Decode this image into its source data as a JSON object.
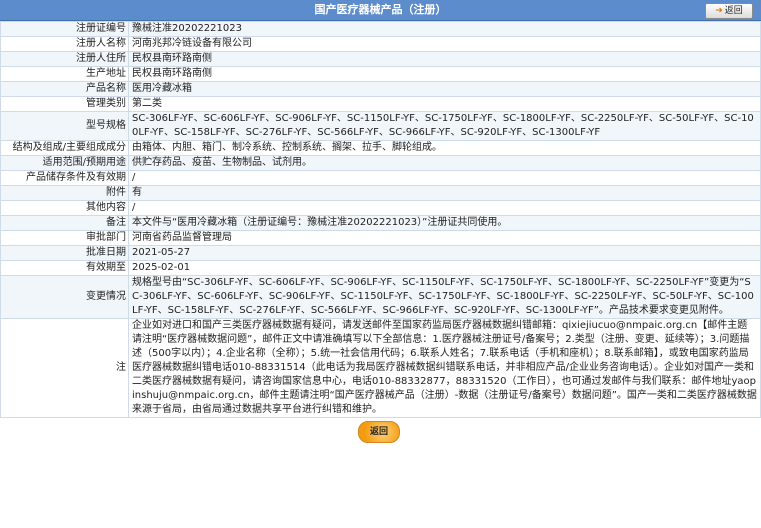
{
  "header": {
    "title": "国产医疗器械产品（注册）",
    "back_label": "返回"
  },
  "rows": [
    {
      "key": "注册证编号",
      "value": "豫械注准20202221023"
    },
    {
      "key": "注册人名称",
      "value": "河南兆邦冷链设备有限公司"
    },
    {
      "key": "注册人住所",
      "value": "民权县南环路南侧"
    },
    {
      "key": "生产地址",
      "value": "民权县南环路南侧"
    },
    {
      "key": "产品名称",
      "value": "医用冷藏冰箱"
    },
    {
      "key": "管理类别",
      "value": "第二类"
    },
    {
      "key": "型号规格",
      "value": "SC-306LF-YF、SC-606LF-YF、SC-906LF-YF、SC-1150LF-YF、SC-1750LF-YF、SC-1800LF-YF、SC-2250LF-YF、SC-50LF-YF、SC-100LF-YF、SC-158LF-YF、SC-276LF-YF、SC-566LF-YF、SC-966LF-YF、SC-920LF-YF、SC-1300LF-YF"
    },
    {
      "key": "结构及组成/主要组成成分",
      "value": "由箱体、内胆、箱门、制冷系统、控制系统、搁架、拉手、脚轮组成。"
    },
    {
      "key": "适用范围/预期用途",
      "value": "供贮存药品、疫苗、生物制品、试剂用。"
    },
    {
      "key": "产品储存条件及有效期",
      "value": "/"
    },
    {
      "key": "附件",
      "value": "有"
    },
    {
      "key": "其他内容",
      "value": "/"
    },
    {
      "key": "备注",
      "value": "本文件与“医用冷藏冰箱（注册证编号：豫械注准20202221023）”注册证共同使用。"
    },
    {
      "key": "审批部门",
      "value": "河南省药品监督管理局"
    },
    {
      "key": "批准日期",
      "value": "2021-05-27"
    },
    {
      "key": "有效期至",
      "value": "2025-02-01"
    },
    {
      "key": "变更情况",
      "value": "规格型号由“SC-306LF-YF、SC-606LF-YF、SC-906LF-YF、SC-1150LF-YF、SC-1750LF-YF、SC-1800LF-YF、SC-2250LF-YF”变更为“SC-306LF-YF、SC-606LF-YF、SC-906LF-YF、SC-1150LF-YF、SC-1750LF-YF、SC-1800LF-YF、SC-2250LF-YF、SC-50LF-YF、SC-100LF-YF、SC-158LF-YF、SC-276LF-YF、SC-566LF-YF、SC-966LF-YF、SC-920LF-YF、SC-1300LF-YF”。产品技术要求变更见附件。"
    },
    {
      "key": "注",
      "value": "企业如对进口和国产三类医疗器械数据有疑问，请发送邮件至国家药监局医疗器械数据纠错邮箱：qixiejiucuo@nmpaic.org.cn【邮件主题请注明“医疗器械数据问题”，邮件正文中请准确填写以下全部信息：1.医疗器械注册证号/备案号；2.类型（注册、变更、延续等）；3.问题描述（500字以内）；4.企业名称（全称）；5.统一社会信用代码；6.联系人姓名；7.联系电话（手机和座机）；8.联系邮箱】，或致电国家药监局医疗器械数据纠错电话010-88331514（此电话为我局医疗器械数据纠错联系电话，并非相应产品/企业业务咨询电话）。企业如对国产一类和二类医疗器械数据有疑问，请咨询国家信息中心，电话010-88332877，88331520（工作日），也可通过发邮件与我们联系：邮件地址yaopinshuju@nmpaic.org.cn，邮件主题请注明“国产医疗器械产品（注册）-数据（注册证号/备案号）数据问题”。国产一类和二类医疗器械数据来源于省局，由省局通过数据共享平台进行纠错和维护。"
    }
  ],
  "footer": {
    "back_label": "返回"
  }
}
